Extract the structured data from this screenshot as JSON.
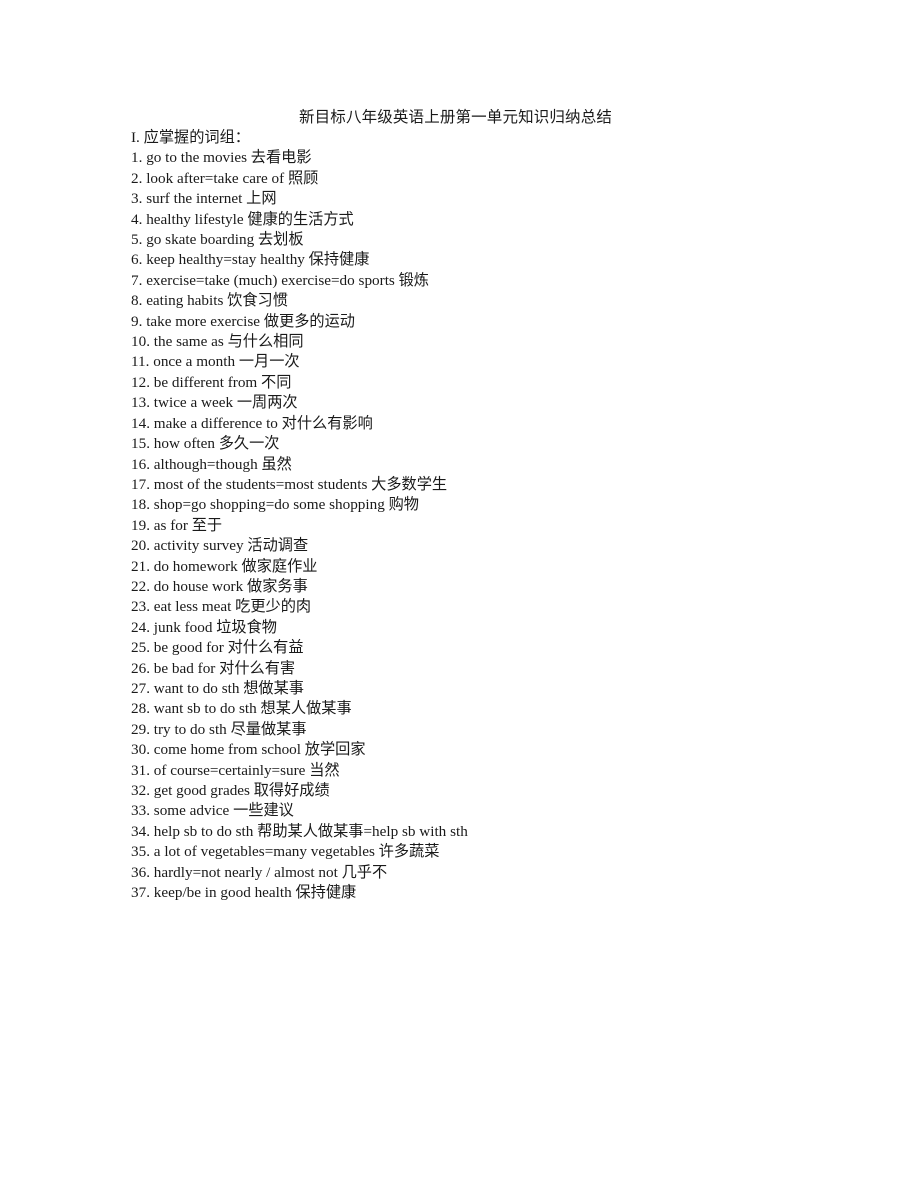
{
  "document": {
    "title": "新目标八年级英语上册第一单元知识归纳总结",
    "section_heading": "I.  应掌握的词组：",
    "vocab_items": [
      {
        "num": "1.",
        "text": "go to the movies  去看电影"
      },
      {
        "num": "2.",
        "text": "look after=take care of  照顾"
      },
      {
        "num": "3.",
        "text": "surf the internet  上网"
      },
      {
        "num": "4.",
        "text": "healthy lifestyle  健康的生活方式"
      },
      {
        "num": "5.",
        "text": "go skate boarding  去划板"
      },
      {
        "num": "6.",
        "text": "keep healthy=stay healthy  保持健康"
      },
      {
        "num": "7.",
        "text": "exercise=take (much) exercise=do sports 锻炼"
      },
      {
        "num": "8.",
        "text": "eating habits  饮食习惯"
      },
      {
        "num": "9.",
        "text": "take more exercise  做更多的运动"
      },
      {
        "num": "10.",
        "text": "the same as  与什么相同"
      },
      {
        "num": "11.",
        "text": "once a month 一月一次"
      },
      {
        "num": "12.",
        "text": "be different from  不同"
      },
      {
        "num": "13.",
        "text": "twice a week 一周两次"
      },
      {
        "num": "14.",
        "text": "make a difference to  对什么有影响"
      },
      {
        "num": "15.",
        "text": "how often  多久一次"
      },
      {
        "num": "16.",
        "text": "although=though 虽然"
      },
      {
        "num": "17.",
        "text": "most of the students=most students 大多数学生"
      },
      {
        "num": "18.",
        "text": "shop=go shopping=do some shopping  购物"
      },
      {
        "num": "19.",
        "text": "as for 至于"
      },
      {
        "num": "20.",
        "text": "activity survey 活动调查"
      },
      {
        "num": "21.",
        "text": "do homework 做家庭作业"
      },
      {
        "num": "22.",
        "text": "do house work 做家务事"
      },
      {
        "num": "23.",
        "text": "eat less meat 吃更少的肉"
      },
      {
        "num": "24.",
        "text": "junk food 垃圾食物"
      },
      {
        "num": "25.",
        "text": "be good for  对什么有益"
      },
      {
        "num": "26.",
        "text": "be bad for 对什么有害"
      },
      {
        "num": "27.",
        "text": "want to do sth  想做某事"
      },
      {
        "num": "28.",
        "text": "want sb to do sth 想某人做某事"
      },
      {
        "num": "29.",
        "text": "try to do sth  尽量做某事"
      },
      {
        "num": "30.",
        "text": "come home from school 放学回家"
      },
      {
        "num": "31.",
        "text": "of course=certainly=sure 当然"
      },
      {
        "num": "32.",
        "text": "get good grades 取得好成绩"
      },
      {
        "num": "33.",
        "text": "some advice  一些建议"
      },
      {
        "num": "34.",
        "text": "help sb to do sth 帮助某人做某事=help sb with sth"
      },
      {
        "num": "35.",
        "text": "a lot of vegetables=many vegetables 许多蔬菜"
      },
      {
        "num": "36.",
        "text": "hardly=not nearly / almost not 几乎不"
      },
      {
        "num": "37.",
        "text": "keep/be in good health 保持健康"
      }
    ]
  }
}
